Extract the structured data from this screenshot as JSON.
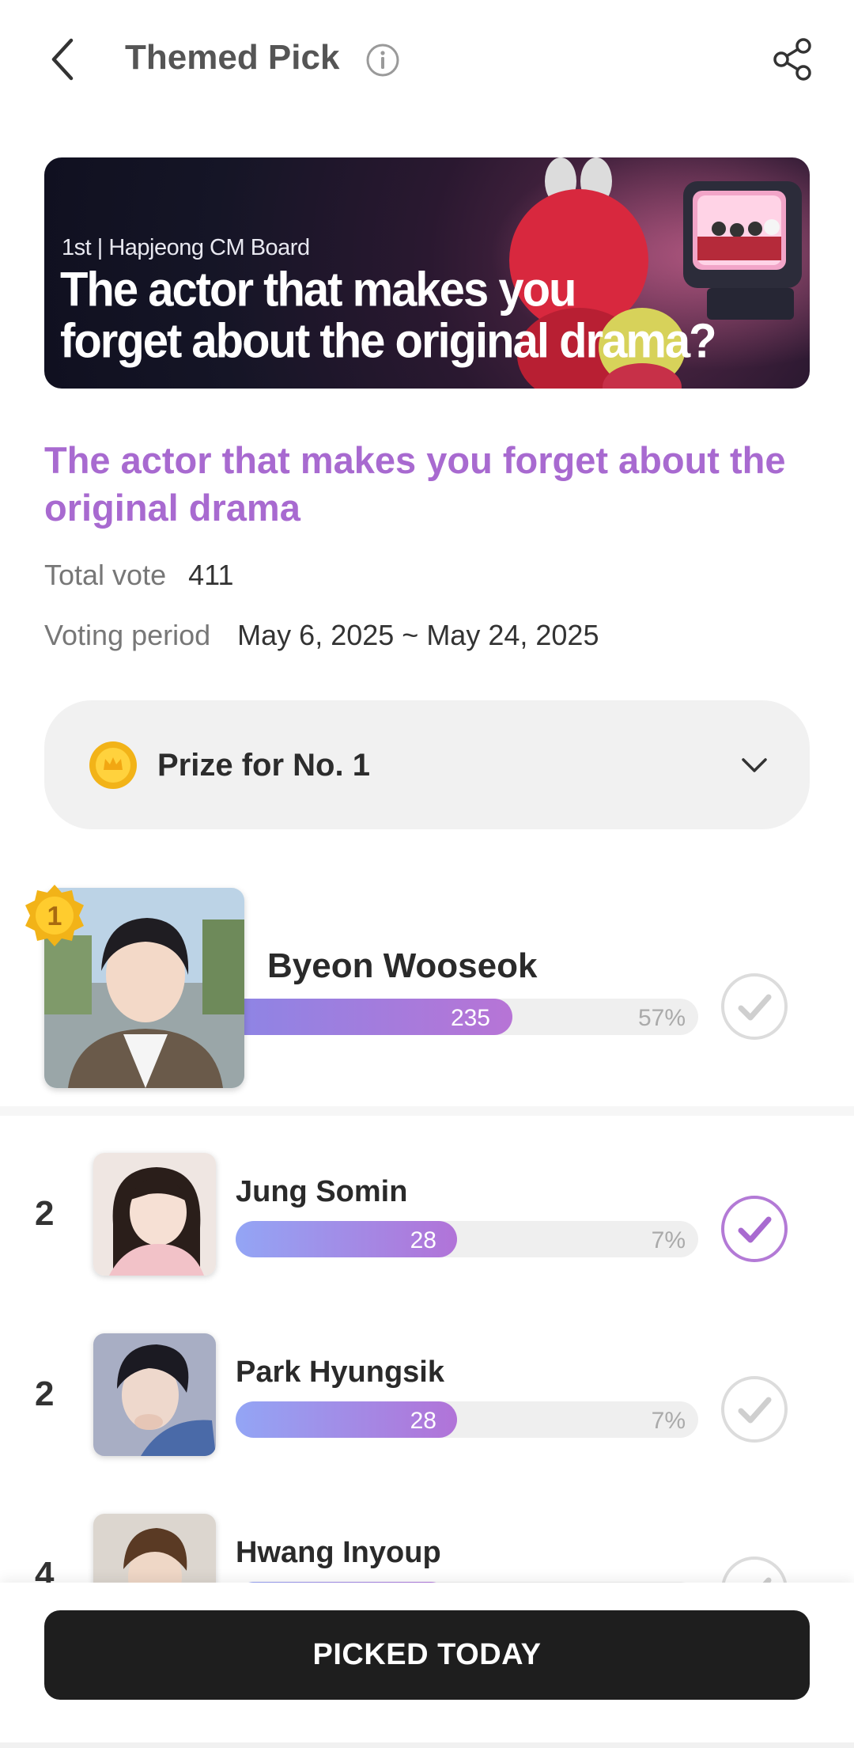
{
  "header": {
    "title": "Themed Pick"
  },
  "banner": {
    "subtitle": "1st | Hapjeong CM Board",
    "headline_line1": "The actor that makes you",
    "headline_line2": "forget about the original drama?"
  },
  "poll": {
    "title": "The actor that makes you forget  about the original drama",
    "total_vote_label": "Total vote",
    "total_vote_value": "411",
    "period_label": "Voting period",
    "period_value": "May 6, 2025 ~ May 24, 2025"
  },
  "prize": {
    "label": "Prize for No. 1"
  },
  "first": {
    "badge": "1",
    "name": "Byeon Wooseok",
    "count": "235",
    "pct": "57%",
    "fill": 0.57
  },
  "candidates": [
    {
      "rank": "2",
      "name": "Jung Somin",
      "count": "28",
      "pct": "7%",
      "fill": 0.07,
      "selected": true
    },
    {
      "rank": "2",
      "name": "Park Hyungsik",
      "count": "28",
      "pct": "7%",
      "fill": 0.07,
      "selected": false
    },
    {
      "rank": "4",
      "name": "Hwang Inyoup",
      "fill": 0.07,
      "selected": false
    }
  ],
  "bottom": {
    "button_label": "PICKED TODAY"
  },
  "colors": {
    "accent": "#a86ad0",
    "bar_start": "#93a5f5",
    "bar_end": "#b173d8",
    "button": "#1e1e1e"
  }
}
